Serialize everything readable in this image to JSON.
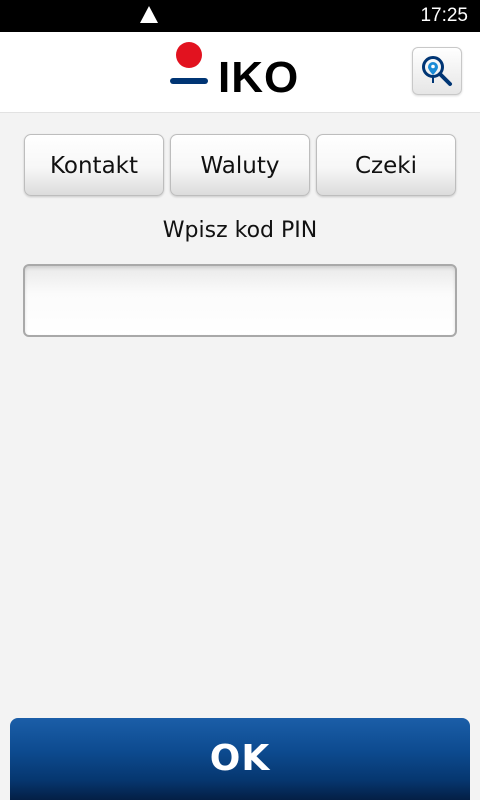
{
  "status_bar": {
    "time": "17:25"
  },
  "header": {
    "logo_text": "IKO"
  },
  "tabs": [
    {
      "label": "Kontakt"
    },
    {
      "label": "Waluty"
    },
    {
      "label": "Czeki"
    }
  ],
  "pin": {
    "label": "Wpisz kod PIN",
    "value": ""
  },
  "ok_button": {
    "label": "OK"
  },
  "colors": {
    "brand_red": "#e2121f",
    "brand_blue": "#003574",
    "ok_button": "#0d4b90",
    "status_bar": "#000000"
  },
  "icons": [
    "warning-icon",
    "map-search-icon"
  ]
}
